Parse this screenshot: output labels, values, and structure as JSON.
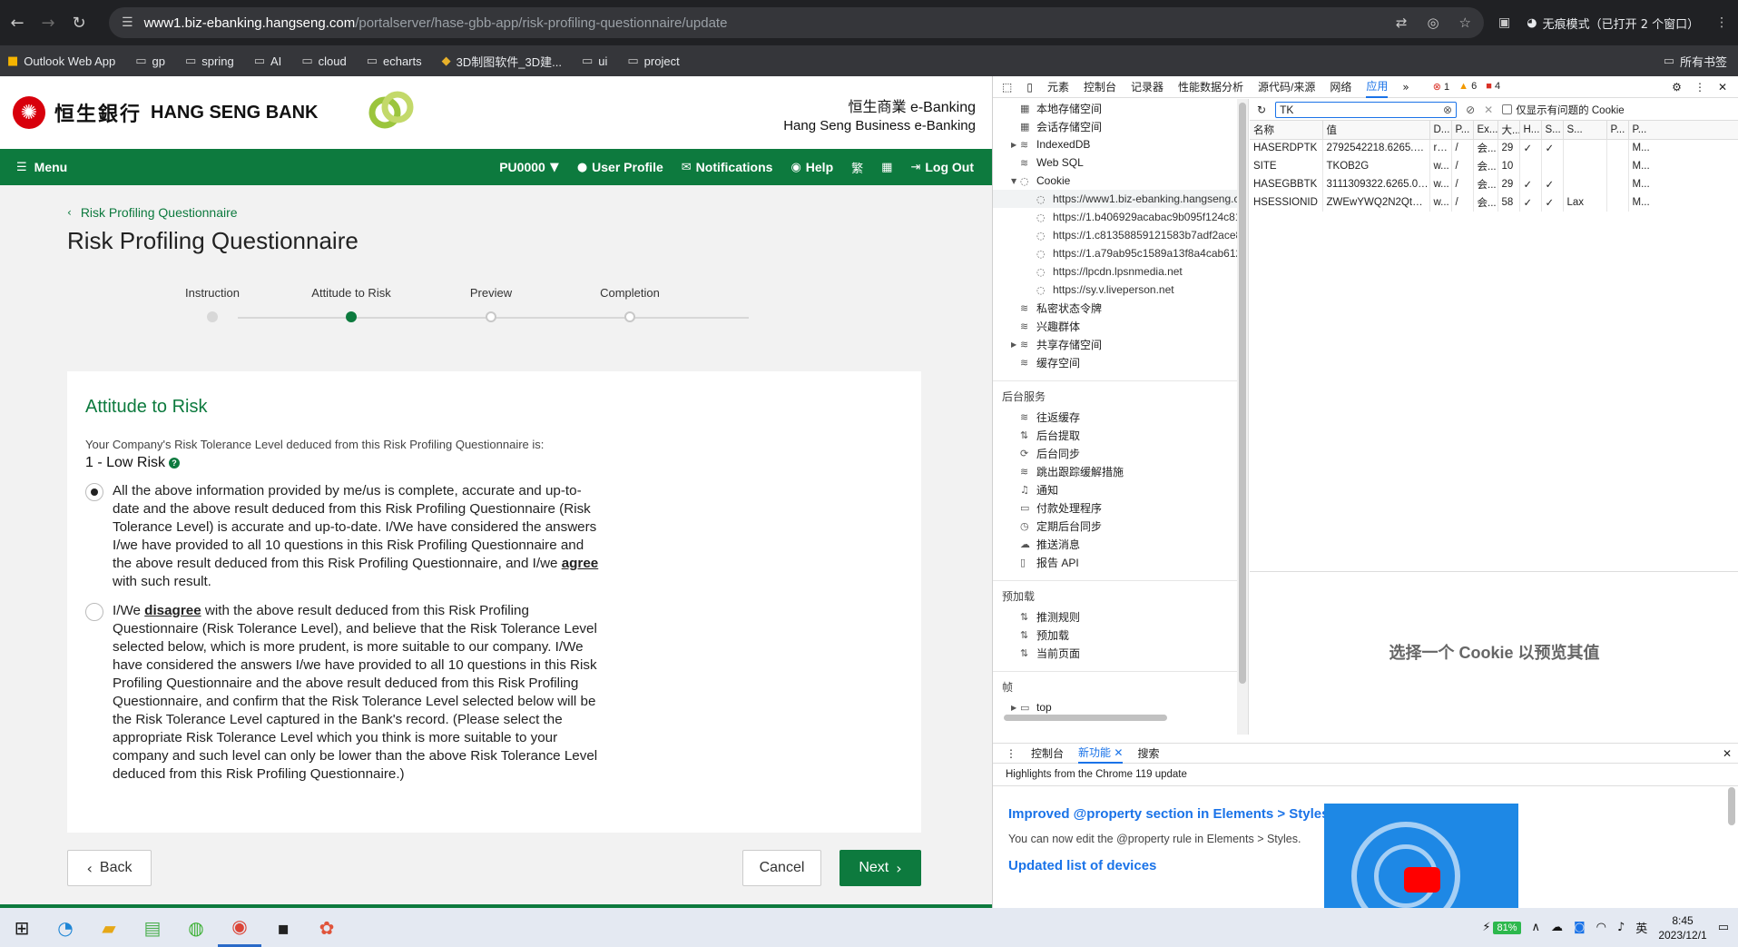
{
  "browser": {
    "url_host": "www1.biz-ebanking.hangseng.com",
    "url_path": "/portalserver/hase-gbb-app/risk-profiling-questionnaire/update",
    "incognito_label": "无痕模式（已打开 2 个窗口）"
  },
  "bookmarks": {
    "items": [
      "Outlook Web App",
      "gp",
      "spring",
      "AI",
      "cloud",
      "echarts",
      "3D制图软件_3D建...",
      "ui",
      "project"
    ],
    "all_label": "所有书签"
  },
  "bank": {
    "name_zh": "恒生銀行",
    "name_en": "HANG SENG BANK",
    "ebank_l1": "恒生商業 e-Banking",
    "ebank_l2": "Hang Seng Business e-Banking"
  },
  "nav": {
    "menu": "Menu",
    "account": "PU0000",
    "user_profile": "User Profile",
    "notifications": "Notifications",
    "help": "Help",
    "logout": "Log Out"
  },
  "page": {
    "breadcrumb": "Risk Profiling Questionnaire",
    "title": "Risk Profiling Questionnaire",
    "steps": [
      "Instruction",
      "Attitude to Risk",
      "Preview",
      "Completion"
    ]
  },
  "card": {
    "title": "Attitude to Risk",
    "subtitle": "Your Company's Risk Tolerance Level deduced from this Risk Profiling Questionnaire is:",
    "risk_level": "1 - Low Risk",
    "opt1_pre": "All the above information provided by me/us is complete, accurate and up-to-date and the above result deduced from this Risk Profiling Questionnaire (Risk Tolerance Level) is accurate and up-to-date. I/We have considered the answers I/we have provided to all 10 questions in this Risk Profiling Questionnaire and the above result deduced from this Risk Profiling Questionnaire, and I/we ",
    "opt1_bold": "agree",
    "opt1_post": " with such result.",
    "opt2_pre": "I/We ",
    "opt2_bold": "disagree",
    "opt2_post": " with the above result deduced from this Risk Profiling Questionnaire (Risk Tolerance Level), and believe that the Risk Tolerance Level selected below, which is more prudent, is more suitable to our company. I/We have considered the answers I/we have provided to all 10 questions in this Risk Profiling Questionnaire and the above result deduced from this Risk Profiling Questionnaire, and confirm that the Risk Tolerance Level selected below will be the Risk Tolerance Level captured in the Bank's record. (Please select the appropriate Risk Tolerance Level which you think is more suitable to your company and such level can only be lower than the above Risk Tolerance Level deduced from this Risk Profiling Questionnaire.)"
  },
  "buttons": {
    "back": "Back",
    "cancel": "Cancel",
    "next": "Next"
  },
  "devtools": {
    "tabs": [
      "元素",
      "控制台",
      "记录器",
      "性能数据分析",
      "源代码/来源",
      "网络",
      "应用"
    ],
    "errors": {
      "err": "1",
      "warn": "6",
      "issues": "4"
    },
    "tree_top": [
      {
        "ar": "",
        "icon": "table",
        "label": "本地存储空间"
      },
      {
        "ar": "",
        "icon": "table",
        "label": "会话存储空间"
      },
      {
        "ar": "▶",
        "icon": "db",
        "label": "IndexedDB"
      },
      {
        "ar": "",
        "icon": "db",
        "label": "Web SQL"
      },
      {
        "ar": "▼",
        "icon": "cookie",
        "label": "Cookie"
      }
    ],
    "cookie_origins": [
      "https://www1.biz-ebanking.hangseng.c",
      "https://1.b406929acabac9b095f124c81",
      "https://1.c81358859121583b7adf2ace8",
      "https://1.a79ab95c1589a13f8a4cab612",
      "https://lpcdn.lpsnmedia.net",
      "https://sy.v.liveperson.net"
    ],
    "tree_more": [
      "私密状态令牌",
      "兴趣群体",
      "共享存储空间",
      "缓存空间"
    ],
    "bg_title": "后台服务",
    "bg_items": [
      "往返缓存",
      "后台提取",
      "后台同步",
      "跳出跟踪缓解措施",
      "通知",
      "付款处理程序",
      "定期后台同步",
      "推送消息",
      "报告 API"
    ],
    "preload_title": "预加载",
    "preload_items": [
      "推测规则",
      "预加载",
      "当前页面"
    ],
    "frames_title": "帧",
    "frames_item": "top",
    "filter_value": "TK",
    "filter_checkbox": "仅显示有问题的 Cookie",
    "cookie_headers": [
      "名称",
      "值",
      "D...",
      "P...",
      "Ex...",
      "大...",
      "H...",
      "S...",
      "S...",
      "P...",
      "P..."
    ],
    "cookies": [
      [
        "HASERDPTK",
        "2792542218.6265.0000",
        "rd...",
        "/",
        "会...",
        "29",
        "✓",
        "✓",
        "",
        "",
        "M..."
      ],
      [
        "SITE",
        "TKOB2G",
        "w...",
        "/",
        "会...",
        "10",
        "",
        "",
        "",
        "",
        "M..."
      ],
      [
        "HASEGBBTK",
        "3111309322.6265.0000",
        "w...",
        "/",
        "会...",
        "29",
        "✓",
        "✓",
        "",
        "",
        "M..."
      ],
      [
        "HSESSIONID",
        "ZWEwYWQ2N2QtYTI3Y...",
        "w...",
        "/",
        "会...",
        "58",
        "✓",
        "✓",
        "Lax",
        "",
        "M..."
      ]
    ],
    "preview_empty": "选择一个 Cookie 以预览其值",
    "drawer_tabs": [
      "控制台",
      "新功能",
      "搜索"
    ],
    "highlights": "Highlights from the Chrome 119 update",
    "wn1_title": "Improved @property section in Elements > Styles",
    "wn1_text": "You can now edit the @property rule in Elements > Styles.",
    "wn2_title": "Updated list of devices"
  },
  "taskbar": {
    "battery": "81%",
    "ime": "英",
    "time": "8:45",
    "date": "2023/12/1"
  },
  "colors": {
    "brand_green": "#0d7a3e",
    "devtools_blue": "#1a73e8"
  }
}
